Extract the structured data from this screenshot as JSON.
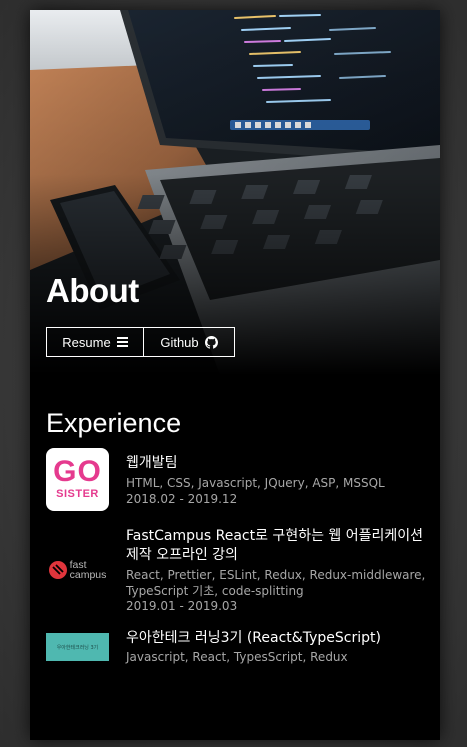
{
  "hero": {
    "title": "About",
    "buttons": [
      {
        "label": "Resume",
        "icon": "list-icon"
      },
      {
        "label": "Github",
        "icon": "github-icon"
      }
    ]
  },
  "experience": {
    "title": "Experience",
    "items": [
      {
        "logo": {
          "line1": "GO",
          "line2": "SISTER"
        },
        "name": "웹개발팀",
        "tech": "HTML, CSS, Javascript, JQuery, ASP, MSSQL",
        "period": "2018.02 - 2019.12"
      },
      {
        "logo": {
          "line1": "fast",
          "line2": "campus"
        },
        "name": "FastCampus React로 구현하는 웹 어플리케이션 제작 오프라인 강의",
        "tech": "React, Prettier, ESLint, Redux, Redux-middleware, TypeScript 기초, code-splitting",
        "period": "2019.01 - 2019.03"
      },
      {
        "logo": {
          "text": "우아한테크러닝 3기"
        },
        "name": "우아한테크 러닝3기 (React&TypeScript)",
        "tech": "Javascript, React, TypesScript, Redux",
        "period": ""
      }
    ]
  },
  "colors": {
    "background": "#000000",
    "text": "#ffffff",
    "muted": "#a7a7a7",
    "gosister_pink": "#e53a8e",
    "fastcampus_red": "#e0353c",
    "woowa_teal": "#4fb8b0"
  }
}
